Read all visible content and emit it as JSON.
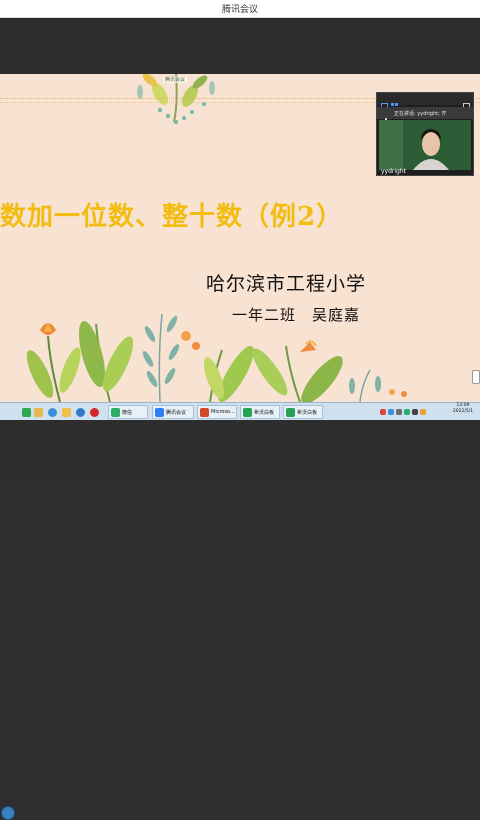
{
  "window": {
    "title": "腾讯会议"
  },
  "slide": {
    "meeting_tag": "腾讯会议",
    "heading": "数加一位数、整十数（例2）",
    "school": "哈尔滨市工程小学",
    "class_name": "一年二班　吴庭嘉"
  },
  "video": {
    "speaking_label": "正在讲话: yydright; 齐",
    "user_name": "yydright"
  },
  "taskbar": {
    "items": [
      {
        "label": "微信",
        "icon": "wechat-icon",
        "color": "#2aae67"
      },
      {
        "label": "腾讯会议",
        "icon": "tencent-meeting-icon",
        "color": "#2d7ff9"
      },
      {
        "label": "Microso...",
        "icon": "powerpoint-icon",
        "color": "#d24726"
      },
      {
        "label": "希沃白板",
        "icon": "seewo-icon",
        "color": "#23a455"
      },
      {
        "label": "希沃白板",
        "icon": "seewo-icon",
        "color": "#23a455"
      }
    ],
    "clock_time": "13:09",
    "clock_date": "2022/5/1"
  }
}
